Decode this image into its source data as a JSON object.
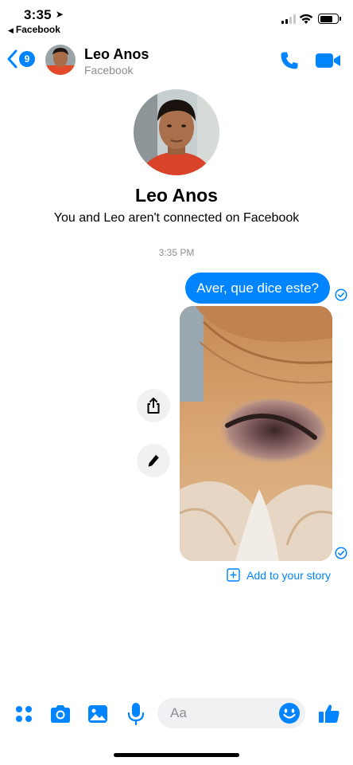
{
  "status_bar": {
    "time": "3:35",
    "back_app": "Facebook"
  },
  "header": {
    "unread_count": "9",
    "contact_name": "Leo Anos",
    "contact_source": "Facebook"
  },
  "profile": {
    "name": "Leo Anos",
    "note": "You and Leo aren't connected on Facebook"
  },
  "conversation": {
    "timestamp": "3:35 PM",
    "messages": [
      {
        "type": "text",
        "text": "Aver, que dice este?",
        "sender": "me"
      },
      {
        "type": "photo",
        "sender": "me"
      }
    ],
    "add_story_label": "Add to your story"
  },
  "composer": {
    "placeholder": "Aa"
  },
  "colors": {
    "accent": "#0084ff",
    "bubble_text": "#ffffff",
    "secondary_text": "#8e8e93",
    "input_bg": "#f1f1f3"
  },
  "icons": {
    "back": "chevron-left-icon",
    "call": "phone-icon",
    "video": "video-camera-icon",
    "share": "share-icon",
    "edit": "pencil-icon",
    "seen": "check-circle-icon",
    "story": "plus-square-icon",
    "apps": "four-dots-icon",
    "camera": "camera-icon",
    "gallery": "image-icon",
    "voice": "microphone-icon",
    "emoji": "smiley-icon",
    "like": "thumbs-up-icon"
  }
}
